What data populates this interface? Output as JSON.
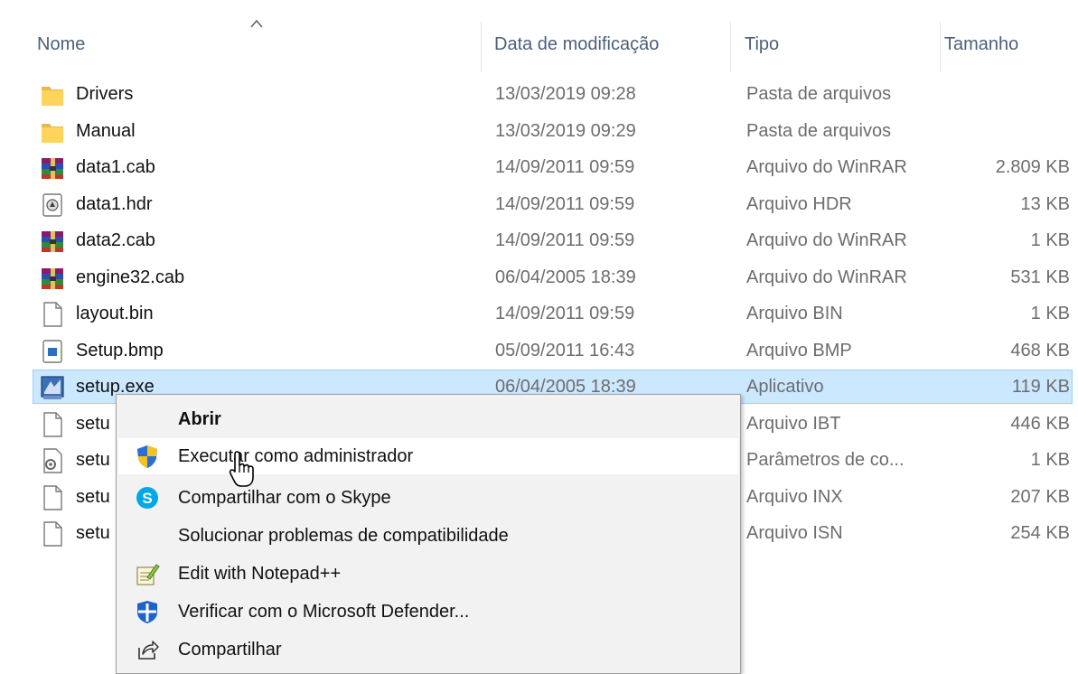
{
  "columns": {
    "name": "Nome",
    "date": "Data de modificação",
    "type": "Tipo",
    "size": "Tamanho"
  },
  "files": [
    {
      "name": "Drivers",
      "date": "13/03/2019 09:28",
      "type": "Pasta de arquivos",
      "size": "",
      "icon": "folder-icon"
    },
    {
      "name": "Manual",
      "date": "13/03/2019 09:29",
      "type": "Pasta de arquivos",
      "size": "",
      "icon": "folder-icon"
    },
    {
      "name": "data1.cab",
      "date": "14/09/2011 09:59",
      "type": "Arquivo do WinRAR",
      "size": "2.809 KB",
      "icon": "winrar-icon"
    },
    {
      "name": "data1.hdr",
      "date": "14/09/2011 09:59",
      "type": "Arquivo HDR",
      "size": "13 KB",
      "icon": "hdr-file-icon"
    },
    {
      "name": "data2.cab",
      "date": "14/09/2011 09:59",
      "type": "Arquivo do WinRAR",
      "size": "1 KB",
      "icon": "winrar-icon"
    },
    {
      "name": "engine32.cab",
      "date": "06/04/2005 18:39",
      "type": "Arquivo do WinRAR",
      "size": "531 KB",
      "icon": "winrar-icon"
    },
    {
      "name": "layout.bin",
      "date": "14/09/2011 09:59",
      "type": "Arquivo BIN",
      "size": "1 KB",
      "icon": "blank-file-icon"
    },
    {
      "name": "Setup.bmp",
      "date": "05/09/2011 16:43",
      "type": "Arquivo BMP",
      "size": "468 KB",
      "icon": "bitmap-file-icon"
    },
    {
      "name": "setup.exe",
      "date": "06/04/2005 18:39",
      "type": "Aplicativo",
      "size": "119 KB",
      "icon": "setup-exe-icon"
    },
    {
      "name": "setu",
      "date": "",
      "type": "Arquivo IBT",
      "size": "446 KB",
      "icon": "blank-file-icon"
    },
    {
      "name": "setu",
      "date": "",
      "type": "Parâmetros de co...",
      "size": "1 KB",
      "icon": "settings-file-icon"
    },
    {
      "name": "setu",
      "date": "",
      "type": "Arquivo INX",
      "size": "207 KB",
      "icon": "blank-file-icon"
    },
    {
      "name": "setu",
      "date": "",
      "type": "Arquivo ISN",
      "size": "254 KB",
      "icon": "blank-file-icon"
    }
  ],
  "selected_file": "setup.exe",
  "context_menu": {
    "items": [
      {
        "label": "Abrir",
        "bold": true,
        "icon": ""
      },
      {
        "label": "Executar como administrador",
        "bold": false,
        "icon": "uac-shield-icon",
        "hover": true
      },
      {
        "label": "Compartilhar com o Skype",
        "bold": false,
        "icon": "skype-icon"
      },
      {
        "label": "Solucionar problemas de compatibilidade",
        "bold": false,
        "icon": ""
      },
      {
        "label": "Edit with Notepad++",
        "bold": false,
        "icon": "notepad-plus-plus-icon"
      },
      {
        "label": "Verificar com o Microsoft Defender...",
        "bold": false,
        "icon": "defender-icon"
      },
      {
        "label": "Compartilhar",
        "bold": false,
        "icon": "share-icon"
      }
    ]
  },
  "colors": {
    "header_text": "#4c607a",
    "selection_bg": "#cce8ff",
    "selection_border": "#99d1ff",
    "menu_bg": "#f2f2f2",
    "menu_hover": "#ffffff"
  }
}
